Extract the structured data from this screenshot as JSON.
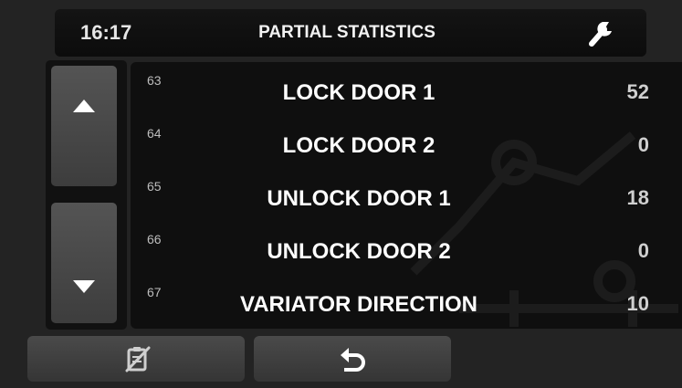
{
  "header": {
    "time": "16:17",
    "title": "PARTIAL STATISTICS",
    "settings_icon": "wrench-icon"
  },
  "scroll": {
    "up_icon": "triangle-up-icon",
    "down_icon": "triangle-down-icon"
  },
  "rows": [
    {
      "index": "63",
      "label": "LOCK DOOR 1",
      "value": "52"
    },
    {
      "index": "64",
      "label": "LOCK DOOR 2",
      "value": "0"
    },
    {
      "index": "65",
      "label": "UNLOCK DOOR 1",
      "value": "18"
    },
    {
      "index": "66",
      "label": "UNLOCK DOOR 2",
      "value": "0"
    },
    {
      "index": "67",
      "label": "VARIATOR DIRECTION",
      "value": "10"
    }
  ],
  "footer": {
    "left_icon": "clear-list-icon",
    "back_icon": "back-arrow-icon"
  },
  "colors": {
    "background": "#232323",
    "panel": "#0f0f0f",
    "text": "#ffffff"
  }
}
